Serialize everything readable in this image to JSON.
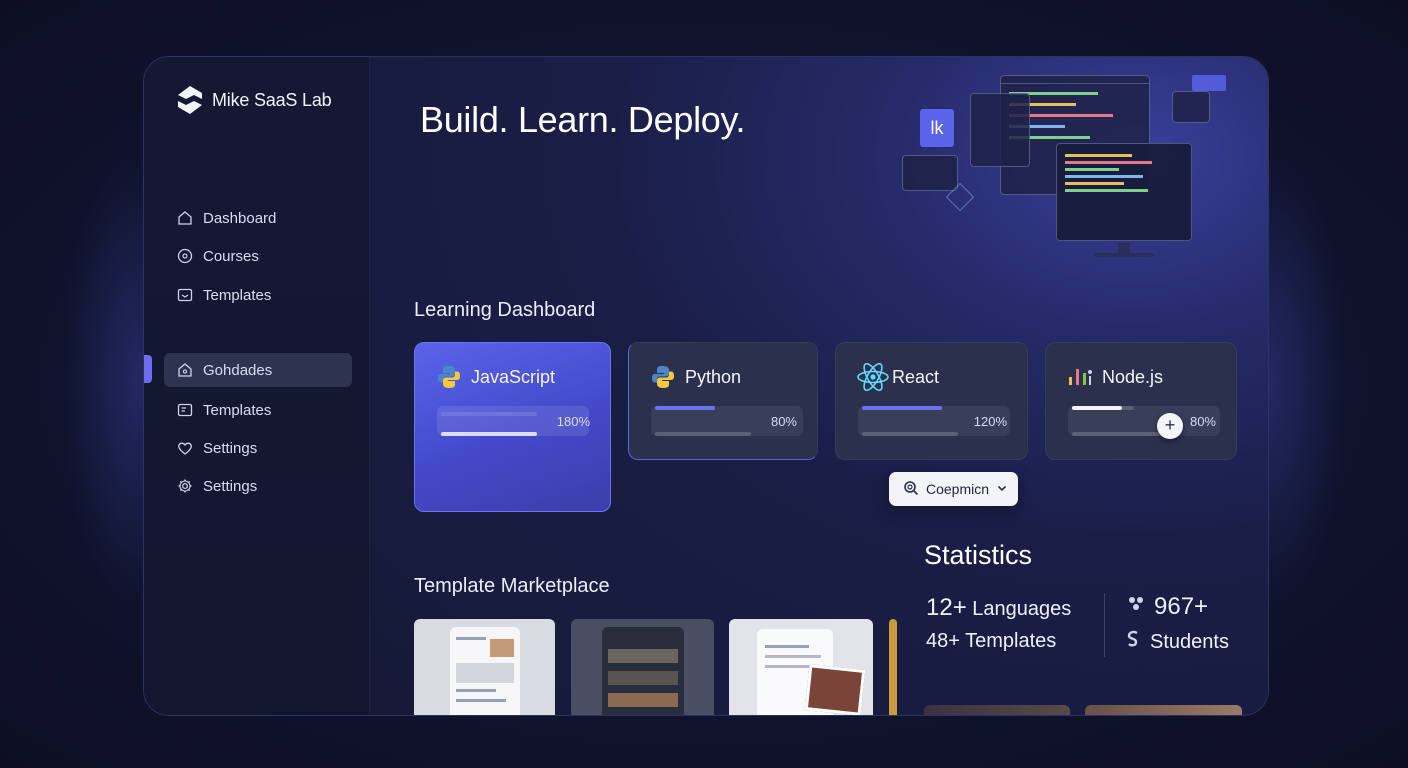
{
  "app": {
    "name": "Mike SaaS Lab"
  },
  "sidebar": {
    "items": [
      {
        "label": "Dashboard",
        "icon": "home-icon"
      },
      {
        "label": "Courses",
        "icon": "compass-icon"
      },
      {
        "label": "Templates",
        "icon": "template-icon"
      },
      {
        "label": "Gohdades",
        "icon": "home-icon",
        "active": true
      },
      {
        "label": "Templates",
        "icon": "template-icon"
      },
      {
        "label": "Settings",
        "icon": "heart-icon"
      },
      {
        "label": "Settings",
        "icon": "gear-icon"
      }
    ]
  },
  "hero": {
    "title": "Build. Learn. Deploy."
  },
  "dashboard": {
    "title": "Learning Dashboard",
    "cards": [
      {
        "name": "JavaScript",
        "icon": "python-icon",
        "percent_label": "180%"
      },
      {
        "name": "Python",
        "icon": "python-icon",
        "percent_label": "80%"
      },
      {
        "name": "React",
        "icon": "react-icon",
        "percent_label": "120%"
      },
      {
        "name": "Node.js",
        "icon": "nodejs-icon",
        "percent_label": "80%"
      }
    ],
    "dropdown": {
      "label": "Coepmicn"
    }
  },
  "marketplace": {
    "title": "Template Marketplace"
  },
  "statistics": {
    "title": "Statistics",
    "languages": {
      "num": "12+",
      "label": "Languages"
    },
    "templates": {
      "num": "48+",
      "label": "Templates"
    },
    "students_count": "967+",
    "students_label": "Students"
  },
  "colors": {
    "accent": "#6f6cf2",
    "highlight_card": "#5a63ea",
    "react": "#61dafb"
  }
}
